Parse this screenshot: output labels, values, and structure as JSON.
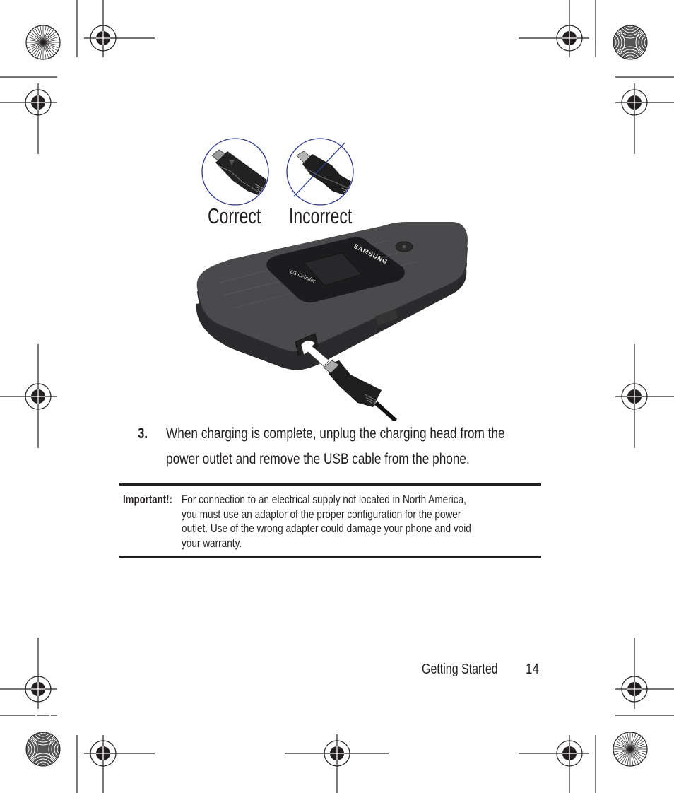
{
  "figure": {
    "label_correct": "Correct",
    "label_incorrect": "Incorrect",
    "phone_brand": "SAMSUNG",
    "phone_carrier": "US Cellular",
    "colors": {
      "circle_stroke": "#2e3a8c",
      "phone_body": "#4a4a4c",
      "phone_dark": "#2a2a2c",
      "screen": "#1c1c1e"
    }
  },
  "step": {
    "number": "3.",
    "text_line1": "When charging is complete, unplug the charging head from the",
    "text_line2": "power outlet and remove the USB cable from the phone."
  },
  "note": {
    "label": "Important!:",
    "lines": [
      "For connection to an electrical supply not located in North America,",
      "you must use an adaptor of the proper configuration for the power",
      "outlet. Use of the wrong adapter could damage your phone and void",
      "your warranty."
    ]
  },
  "footer": {
    "section": "Getting Started",
    "page_number": "14"
  }
}
